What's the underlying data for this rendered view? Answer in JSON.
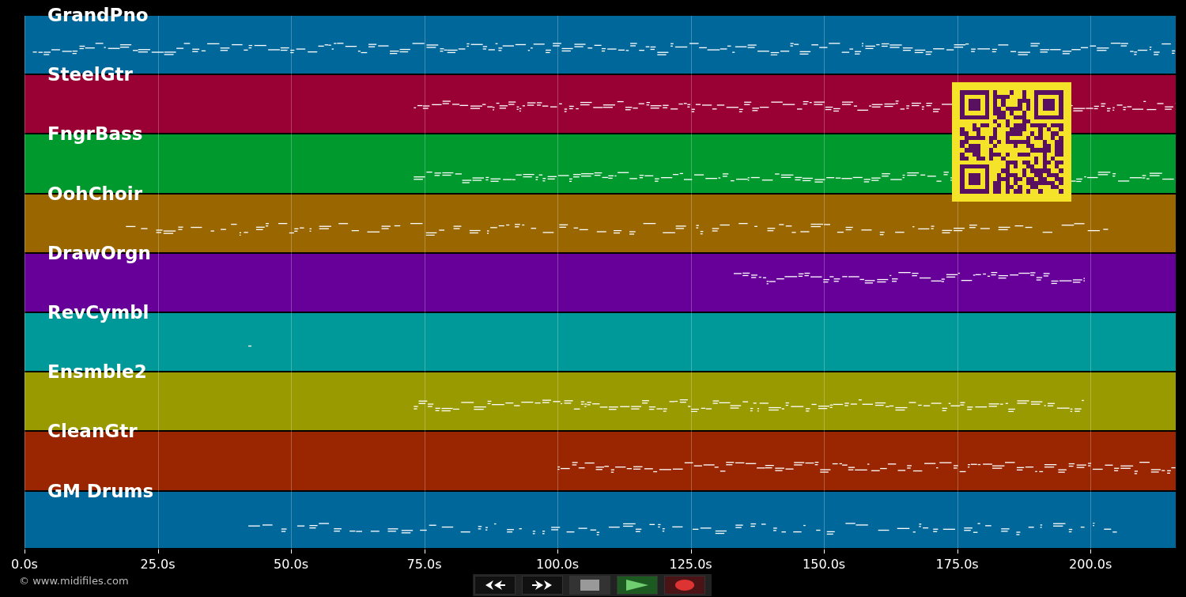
{
  "tracks": [
    {
      "name": "GrandPno",
      "color": "#00679a"
    },
    {
      "name": "SteelGtr",
      "color": "#990033"
    },
    {
      "name": "FngrBass",
      "color": "#00992e"
    },
    {
      "name": "OohChoir",
      "color": "#996600"
    },
    {
      "name": "DrawOrgn",
      "color": "#660099"
    },
    {
      "name": "RevCymbl",
      "color": "#009999"
    },
    {
      "name": "Ensmble2",
      "color": "#999900"
    },
    {
      "name": "CleanGtr",
      "color": "#992600"
    },
    {
      "name": "GM Drums",
      "color": "#00679a"
    }
  ],
  "time_axis": {
    "ticks": [
      "0.0s",
      "25.0s",
      "50.0s",
      "75.0s",
      "100.0s",
      "125.0s",
      "150.0s",
      "175.0s",
      "200.0s"
    ]
  },
  "transport": {
    "buttons": [
      {
        "kind": "rewind"
      },
      {
        "kind": "forward"
      },
      {
        "kind": "stop"
      },
      {
        "kind": "play"
      },
      {
        "kind": "record"
      }
    ]
  },
  "copyright": "© www.midifiles.com"
}
